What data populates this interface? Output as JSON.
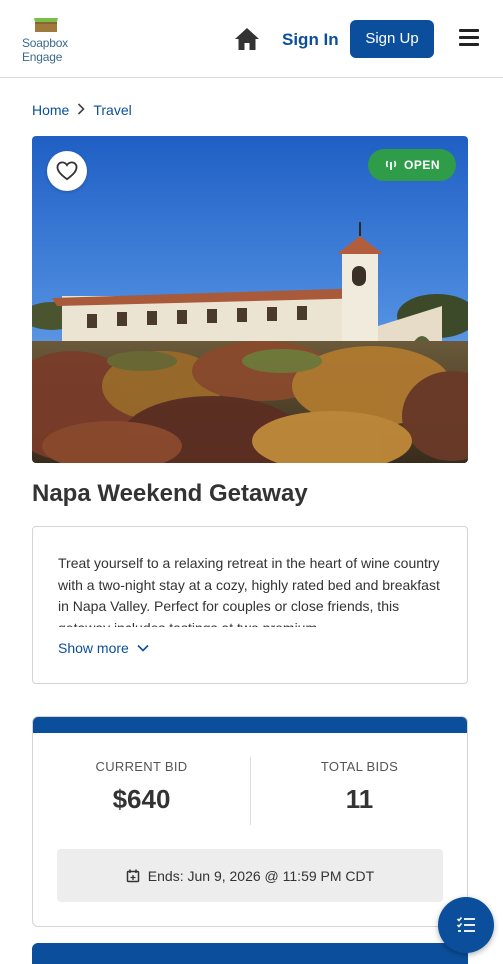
{
  "brand": {
    "logo_text_line1": "Soapbox",
    "logo_text_line2": "Engage"
  },
  "header": {
    "sign_in_label": "Sign In",
    "sign_up_label": "Sign Up"
  },
  "breadcrumb": {
    "items": [
      {
        "label": "Home"
      },
      {
        "label": "Travel"
      }
    ]
  },
  "item": {
    "status": "OPEN",
    "status_color": "#2e9c49",
    "title": "Napa Weekend Getaway",
    "description": "Treat yourself to a relaxing retreat in the heart of wine country with a two-night stay at a cozy, highly rated bed and breakfast in Napa Valley. Perfect for couples or close friends, this getaway includes tastings at two premium",
    "show_more_label": "Show more"
  },
  "bid": {
    "current_bid_label": "CURRENT BID",
    "current_bid_value": "$640",
    "total_bids_label": "TOTAL BIDS",
    "total_bids_value": "11",
    "ends_text": "Ends: Jun 9, 2026 @ 11:59 PM CDT"
  },
  "theme": {
    "primary": "#0b4f9c",
    "success": "#2e9c49"
  }
}
